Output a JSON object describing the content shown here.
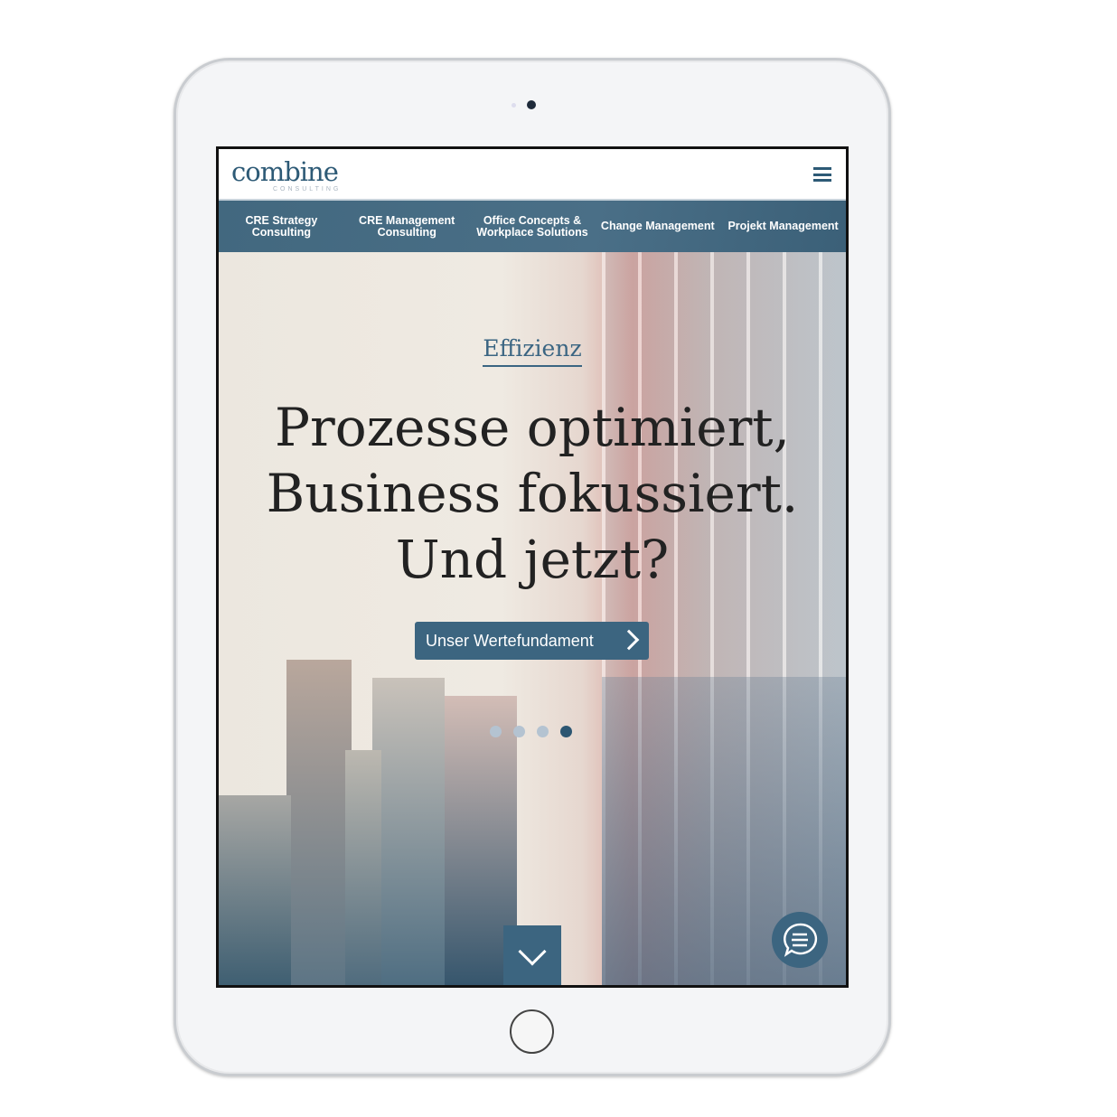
{
  "header": {
    "logo": "combine",
    "logo_sub": "CONSULTING"
  },
  "nav": {
    "items": [
      {
        "label": "CRE Strategy Consulting"
      },
      {
        "label": "CRE Management Consulting"
      },
      {
        "label": "Office Concepts & Workplace Solutions"
      },
      {
        "label": "Change Management"
      },
      {
        "label": "Projekt Management"
      }
    ]
  },
  "hero": {
    "overline": "Effizienz",
    "headline": [
      "Prozesse optimiert,",
      "Business fokussiert.",
      "Und jetzt?"
    ],
    "cta_label": "Unser Wertefundament",
    "slides": 4,
    "active_slide": 4
  },
  "colors": {
    "brand": "#3c6580",
    "nav": "#42687f"
  }
}
